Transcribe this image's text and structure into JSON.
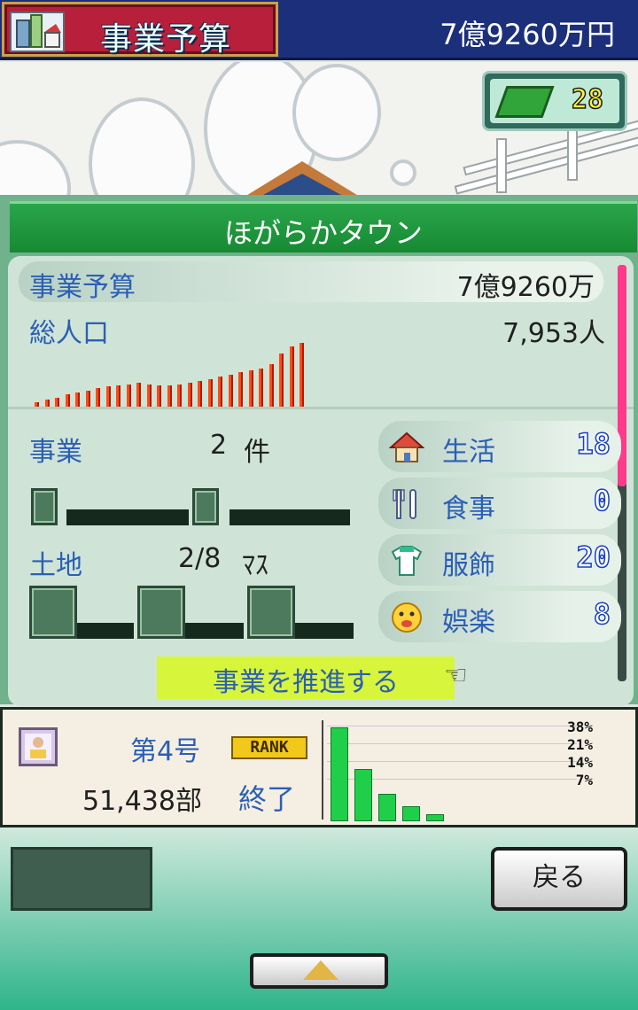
{
  "header": {
    "title": "事業予算",
    "budget": "7億9260万円"
  },
  "badge": {
    "icon": "book-icon",
    "count": "28"
  },
  "town": {
    "name": "ほがらかタウン",
    "budget_label": "事業予算",
    "budget_value": "7億9260万",
    "population_label": "総人口",
    "population_value": "7,953人",
    "business_label": "事業",
    "business_count": "2",
    "business_unit": "件",
    "land_label": "土地",
    "land_value": "2/8",
    "land_unit": "ﾏｽ",
    "promote_label": "事業を推進する"
  },
  "population_trend": [
    6,
    8,
    10,
    13,
    15,
    17,
    19,
    21,
    22,
    23,
    24,
    23,
    22,
    22,
    23,
    24,
    26,
    28,
    30,
    32,
    34,
    36,
    38,
    42,
    52,
    59,
    62
  ],
  "categories": [
    {
      "label": "生活",
      "value": "18",
      "icon": "house-icon"
    },
    {
      "label": "食事",
      "value": "0",
      "icon": "fork-knife-icon"
    },
    {
      "label": "服飾",
      "value": "20",
      "icon": "shirt-icon"
    },
    {
      "label": "娯楽",
      "value": "8",
      "icon": "smile-face-icon"
    }
  ],
  "news": {
    "issue": "第4号",
    "rank_label": "RANK",
    "copies": "51,438部",
    "status": "終了",
    "chart_data": {
      "type": "bar",
      "values": [
        38,
        21,
        11,
        6,
        3
      ],
      "legend": [
        "38%",
        "21%",
        "14%",
        "7%"
      ]
    }
  },
  "footer": {
    "back_label": "戻る"
  }
}
